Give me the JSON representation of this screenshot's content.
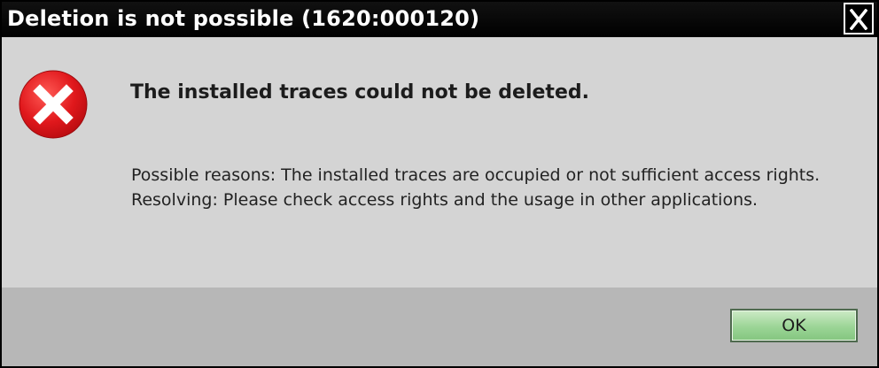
{
  "dialog": {
    "title": "Deletion is not possible (1620:000120)",
    "close_icon": "close-icon",
    "error_icon": "error-icon",
    "heading": "The installed traces could not be deleted.",
    "reasons": "Possible reasons: The installed traces are occupied or not sufficient access rights.",
    "resolving": "Resolving: Please check access rights and the usage in other applications.",
    "ok_label": "OK"
  },
  "colors": {
    "title_bar": "#000000",
    "content_bg": "#d4d4d4",
    "footer_bg": "#b7b7b7",
    "error_red": "#e0181c",
    "ok_button": "#9bd596"
  }
}
